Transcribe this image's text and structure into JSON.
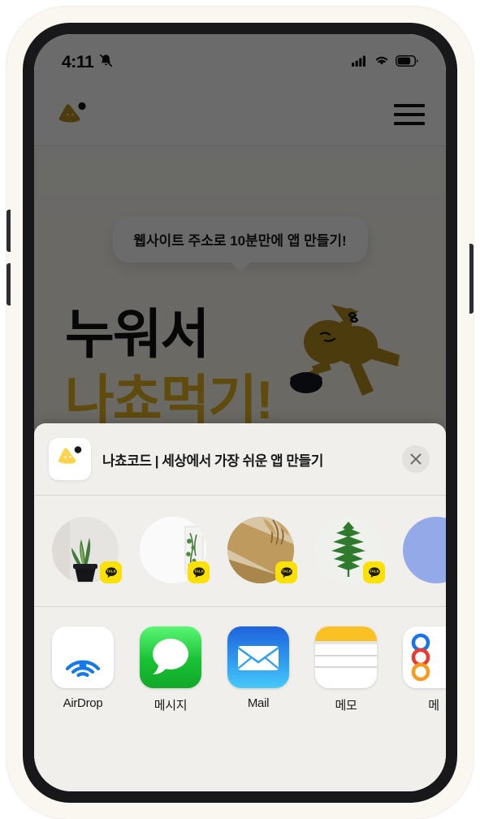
{
  "status_bar": {
    "time": "4:11",
    "silent_icon": "bell-slash-icon",
    "signal_icon": "cellular-signal-icon",
    "wifi_icon": "wifi-icon",
    "battery_icon": "battery-icon",
    "battery_level_pct": 70
  },
  "site_header": {
    "logo_name": "nachocode-logo",
    "menu_name": "hamburger-menu-icon"
  },
  "hero": {
    "tooltip": "웹사이트 주소로 10분만에 앱 만들기!",
    "title_line_1": "누워서",
    "title_line_2": "나쵸먹기!",
    "illustration_name": "person-eating-nachos-illustration",
    "accent_color": "#e0b321",
    "title_color": "#111111"
  },
  "share_sheet": {
    "app_icon_name": "nachocode-app-icon",
    "title": "나쵸코드 | 세상에서 가장 쉬운 앱 만들기",
    "close_label": "✕",
    "contacts": [
      {
        "name": "contact-1",
        "avatar": "potted-snake-plant-photo",
        "badge": "TALK",
        "bg": "#e7e5e1"
      },
      {
        "name": "contact-2",
        "avatar": "white-window-plant-photo",
        "badge": "TALK",
        "bg": "#fbfbfb"
      },
      {
        "name": "contact-3",
        "avatar": "dried-palm-leaves-photo",
        "badge": "TALK",
        "bg": "#c8a56a"
      },
      {
        "name": "contact-4",
        "avatar": "green-fern-leaf-photo",
        "badge": "TALK",
        "bg": "#eef1ea"
      },
      {
        "name": "contact-5",
        "avatar": "blue-circle-avatar",
        "badge": "",
        "bg": "#93a9e8"
      }
    ],
    "apps": [
      {
        "name": "airdrop",
        "label": "AirDrop",
        "icon": "airdrop-icon"
      },
      {
        "name": "messages",
        "label": "메시지",
        "icon": "messages-icon"
      },
      {
        "name": "mail",
        "label": "Mail",
        "icon": "mail-icon"
      },
      {
        "name": "notes",
        "label": "메모",
        "icon": "notes-icon"
      },
      {
        "name": "more-app",
        "label": "메",
        "icon": "colored-dots-app-icon"
      }
    ],
    "badge_color": "#fae100"
  }
}
